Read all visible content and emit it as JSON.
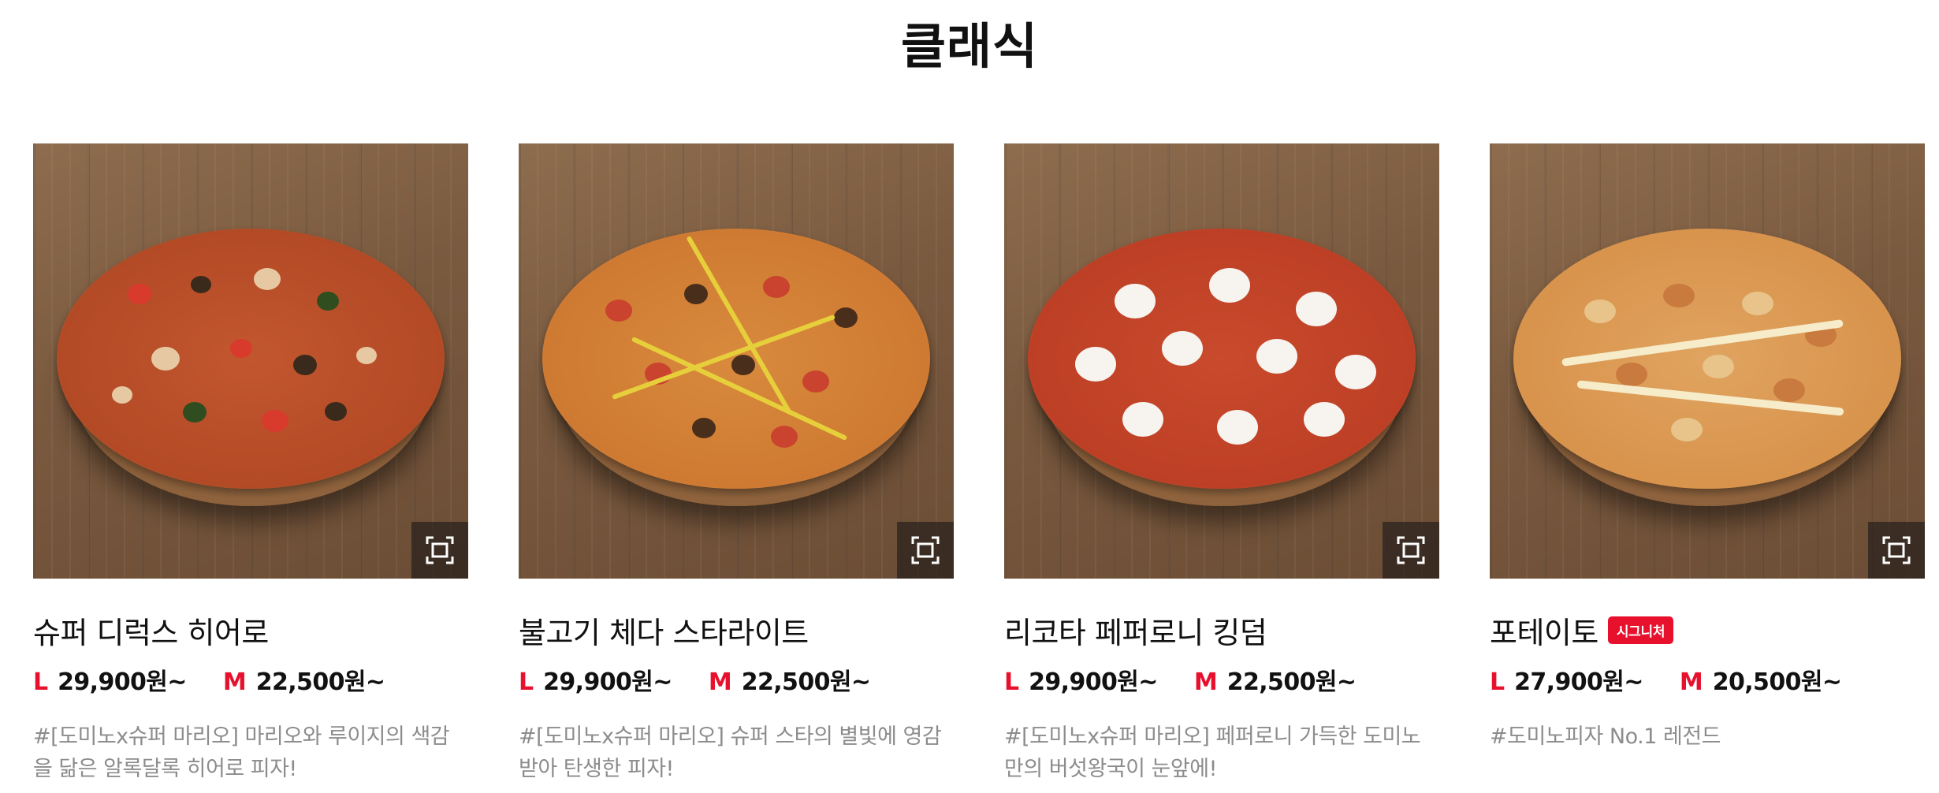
{
  "section": {
    "title": "클래식"
  },
  "products": [
    {
      "name": "슈퍼 디럭스 히어로",
      "badge": "",
      "large": {
        "size": "L",
        "price": "29,900원~"
      },
      "medium": {
        "size": "M",
        "price": "22,500원~"
      },
      "description": "#[도미노x슈퍼 마리오] 마리오와 루이지의 색감을 닮은 알록달록 히어로 피자!"
    },
    {
      "name": "불고기 체다 스타라이트",
      "badge": "",
      "large": {
        "size": "L",
        "price": "29,900원~"
      },
      "medium": {
        "size": "M",
        "price": "22,500원~"
      },
      "description": "#[도미노x슈퍼 마리오] 슈퍼 스타의 별빛에 영감 받아 탄생한 피자!"
    },
    {
      "name": "리코타 페퍼로니 킹덤",
      "badge": "",
      "large": {
        "size": "L",
        "price": "29,900원~"
      },
      "medium": {
        "size": "M",
        "price": "22,500원~"
      },
      "description": "#[도미노x슈퍼 마리오] 페퍼로니 가득한 도미노만의 버섯왕국이 눈앞에!"
    },
    {
      "name": "포테이토",
      "badge": "시그니처",
      "large": {
        "size": "L",
        "price": "27,900원~"
      },
      "medium": {
        "size": "M",
        "price": "20,500원~"
      },
      "description": "#도미노피자 No.1 레전드"
    }
  ],
  "icons": {
    "zoom": "expand-frame-icon"
  },
  "colors": {
    "accent": "#e8112d",
    "text": "#111111",
    "muted": "#8c8c8c"
  }
}
